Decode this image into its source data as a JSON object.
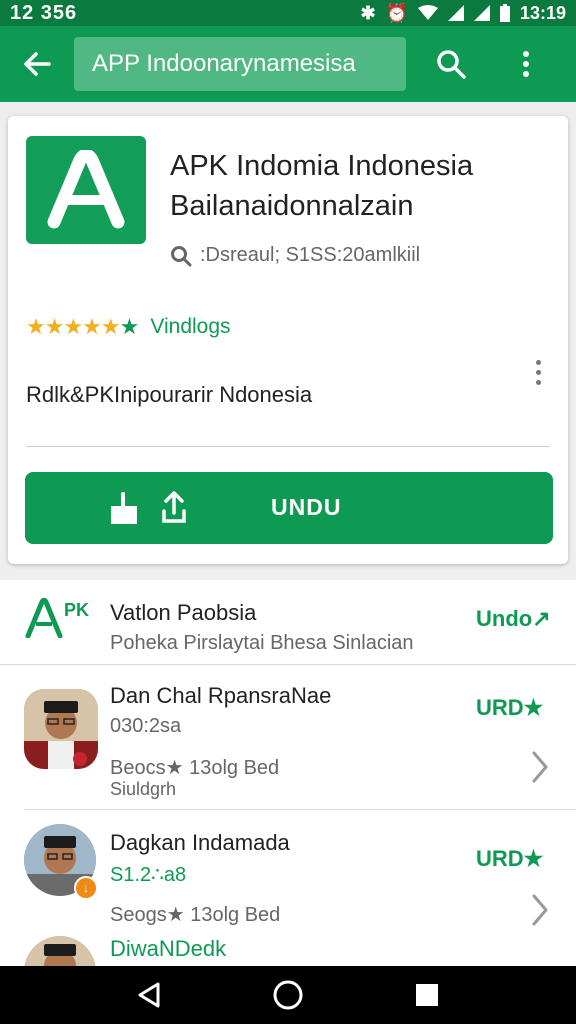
{
  "status_bar": {
    "left_text": "12 356",
    "time": "13:19"
  },
  "app_bar": {
    "search_value": "APP Indoonarynamesisa"
  },
  "hero": {
    "title_line1": "APK Indomia Indonesia",
    "title_line2": "Bailanaidonnalzain",
    "meta": ":Dsreaul; S1SS:20amlkiil",
    "rating_label": "Vindlogs",
    "description": "Rdlk&PKInipourarir Ndonesia",
    "install_label": "UNDU"
  },
  "list": {
    "items": [
      {
        "icon_text": "PK",
        "title": "Vatlon Paobsia",
        "subtitle": "Poheka Pirslaytai Bhesa Sinlacian",
        "action": "Undo↗"
      },
      {
        "title": "Dan Chal RpansraNae",
        "subtitle": "030:2sa",
        "extra_line1": "Beocs★ 13olg Bed",
        "extra_line2": "Siuldgrh",
        "action": "URD★"
      },
      {
        "title": "Dagkan Indamada",
        "subtitle": "S1.2∴a8",
        "extra_line1": "Seogs★ 13olg Bed",
        "action": "URD★"
      },
      {
        "title": "DiwaNDedk"
      }
    ]
  },
  "colors": {
    "primary": "#0f9a54",
    "status_bar": "#0a7a3f",
    "star": "#f2b01e"
  }
}
